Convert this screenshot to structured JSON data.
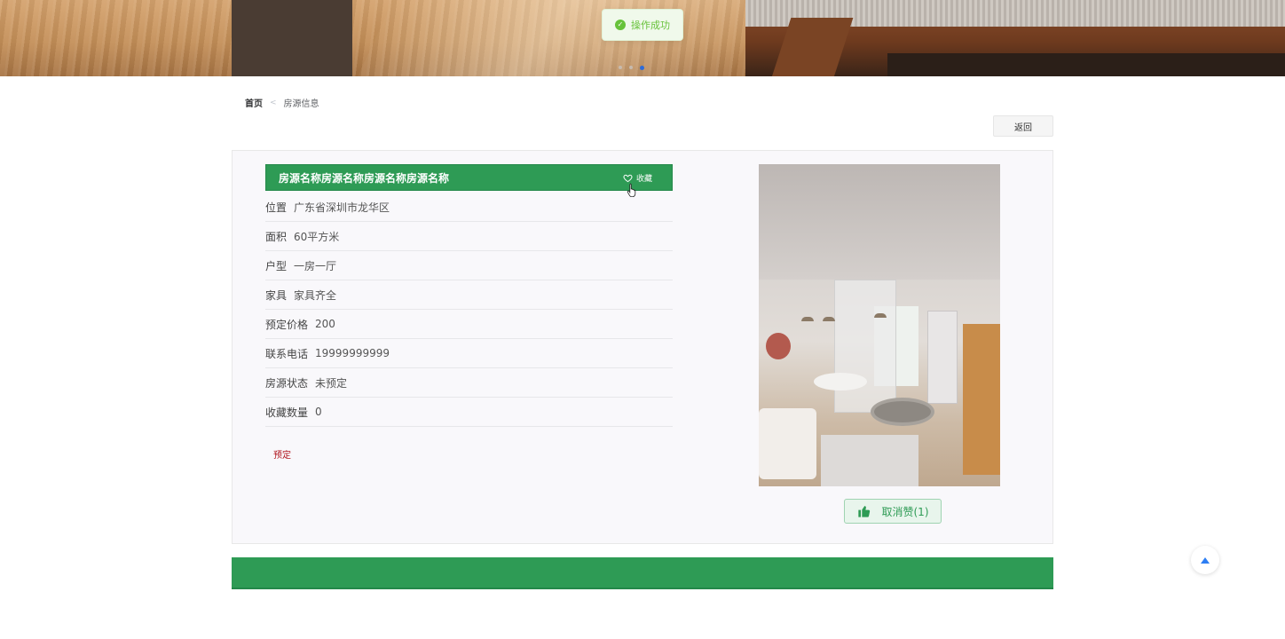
{
  "toast": {
    "message": "操作成功",
    "icon": "check-circle-icon",
    "color": "#67c23a"
  },
  "banner": {
    "carousel_count": 3,
    "active_index": 2
  },
  "breadcrumb": {
    "home": "首页",
    "separator": "<",
    "current": "房源信息"
  },
  "back_button": "返回",
  "listing": {
    "title": "房源名称房源名称房源名称房源名称",
    "favorite_label": "收藏",
    "rows": [
      {
        "label": "位置",
        "value": "广东省深圳市龙华区"
      },
      {
        "label": "面积",
        "value": "60平方米"
      },
      {
        "label": "户型",
        "value": "一房一厅"
      },
      {
        "label": "家具",
        "value": "家具齐全"
      },
      {
        "label": "预定价格",
        "value": "200"
      },
      {
        "label": "联系电话",
        "value": "19999999999"
      },
      {
        "label": "房源状态",
        "value": "未预定"
      },
      {
        "label": "收藏数量",
        "value": "0"
      }
    ],
    "book_label": "预定",
    "unlike_label": "取消赞(1)"
  },
  "colors": {
    "brand_green": "#2e9b55",
    "book_red": "#b0141d",
    "active_dot": "#2d6bd8"
  }
}
